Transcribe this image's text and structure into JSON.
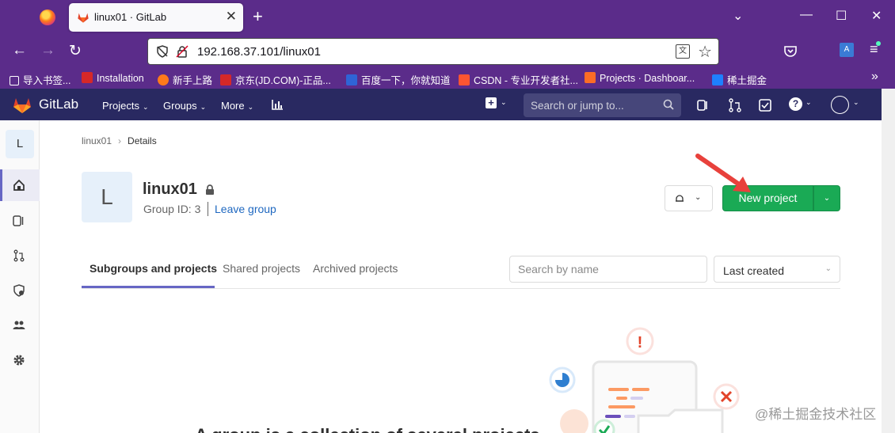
{
  "browser": {
    "tab_title": "linux01 · GitLab",
    "url": "192.168.37.101/linux01",
    "bookmarks": [
      {
        "label": "导入书签...",
        "color": "#ffffff"
      },
      {
        "label": "Installation",
        "color": "#d62828"
      },
      {
        "label": "新手上路",
        "color": "#ff7a1a"
      },
      {
        "label": "京东(JD.COM)-正品...",
        "color": "#d62828"
      },
      {
        "label": "百度一下，你就知道",
        "color": "#2f64d6"
      },
      {
        "label": "CSDN - 专业开发者社...",
        "color": "#fc5531"
      },
      {
        "label": "Projects · Dashboar...",
        "color": "#fc6d26"
      },
      {
        "label": "稀土掘金",
        "color": "#1e80ff"
      }
    ]
  },
  "gitlab_header": {
    "brand": "GitLab",
    "menus": [
      "Projects",
      "Groups",
      "More"
    ],
    "search_placeholder": "Search or jump to..."
  },
  "sidebar": {
    "avatar_letter": "L",
    "items": [
      "group-overview",
      "issues",
      "merge-requests",
      "security",
      "members",
      "settings"
    ]
  },
  "breadcrumb": {
    "parent": "linux01",
    "current": "Details"
  },
  "group": {
    "avatar_letter": "L",
    "name": "linux01",
    "id_text": "Group ID: 3",
    "leave_label": "Leave group"
  },
  "actions": {
    "new_project_label": "New project",
    "accent_color": "#1aaa55"
  },
  "tabs": [
    {
      "label": "Subgroups and projects",
      "active": true
    },
    {
      "label": "Shared projects",
      "active": false
    },
    {
      "label": "Archived projects",
      "active": false
    }
  ],
  "filter": {
    "search_placeholder": "Search by name",
    "sort_value": "Last created"
  },
  "empty_state": {
    "partial_heading": "A group is a collection of several projects"
  },
  "watermark": "@稀土掘金技术社区"
}
